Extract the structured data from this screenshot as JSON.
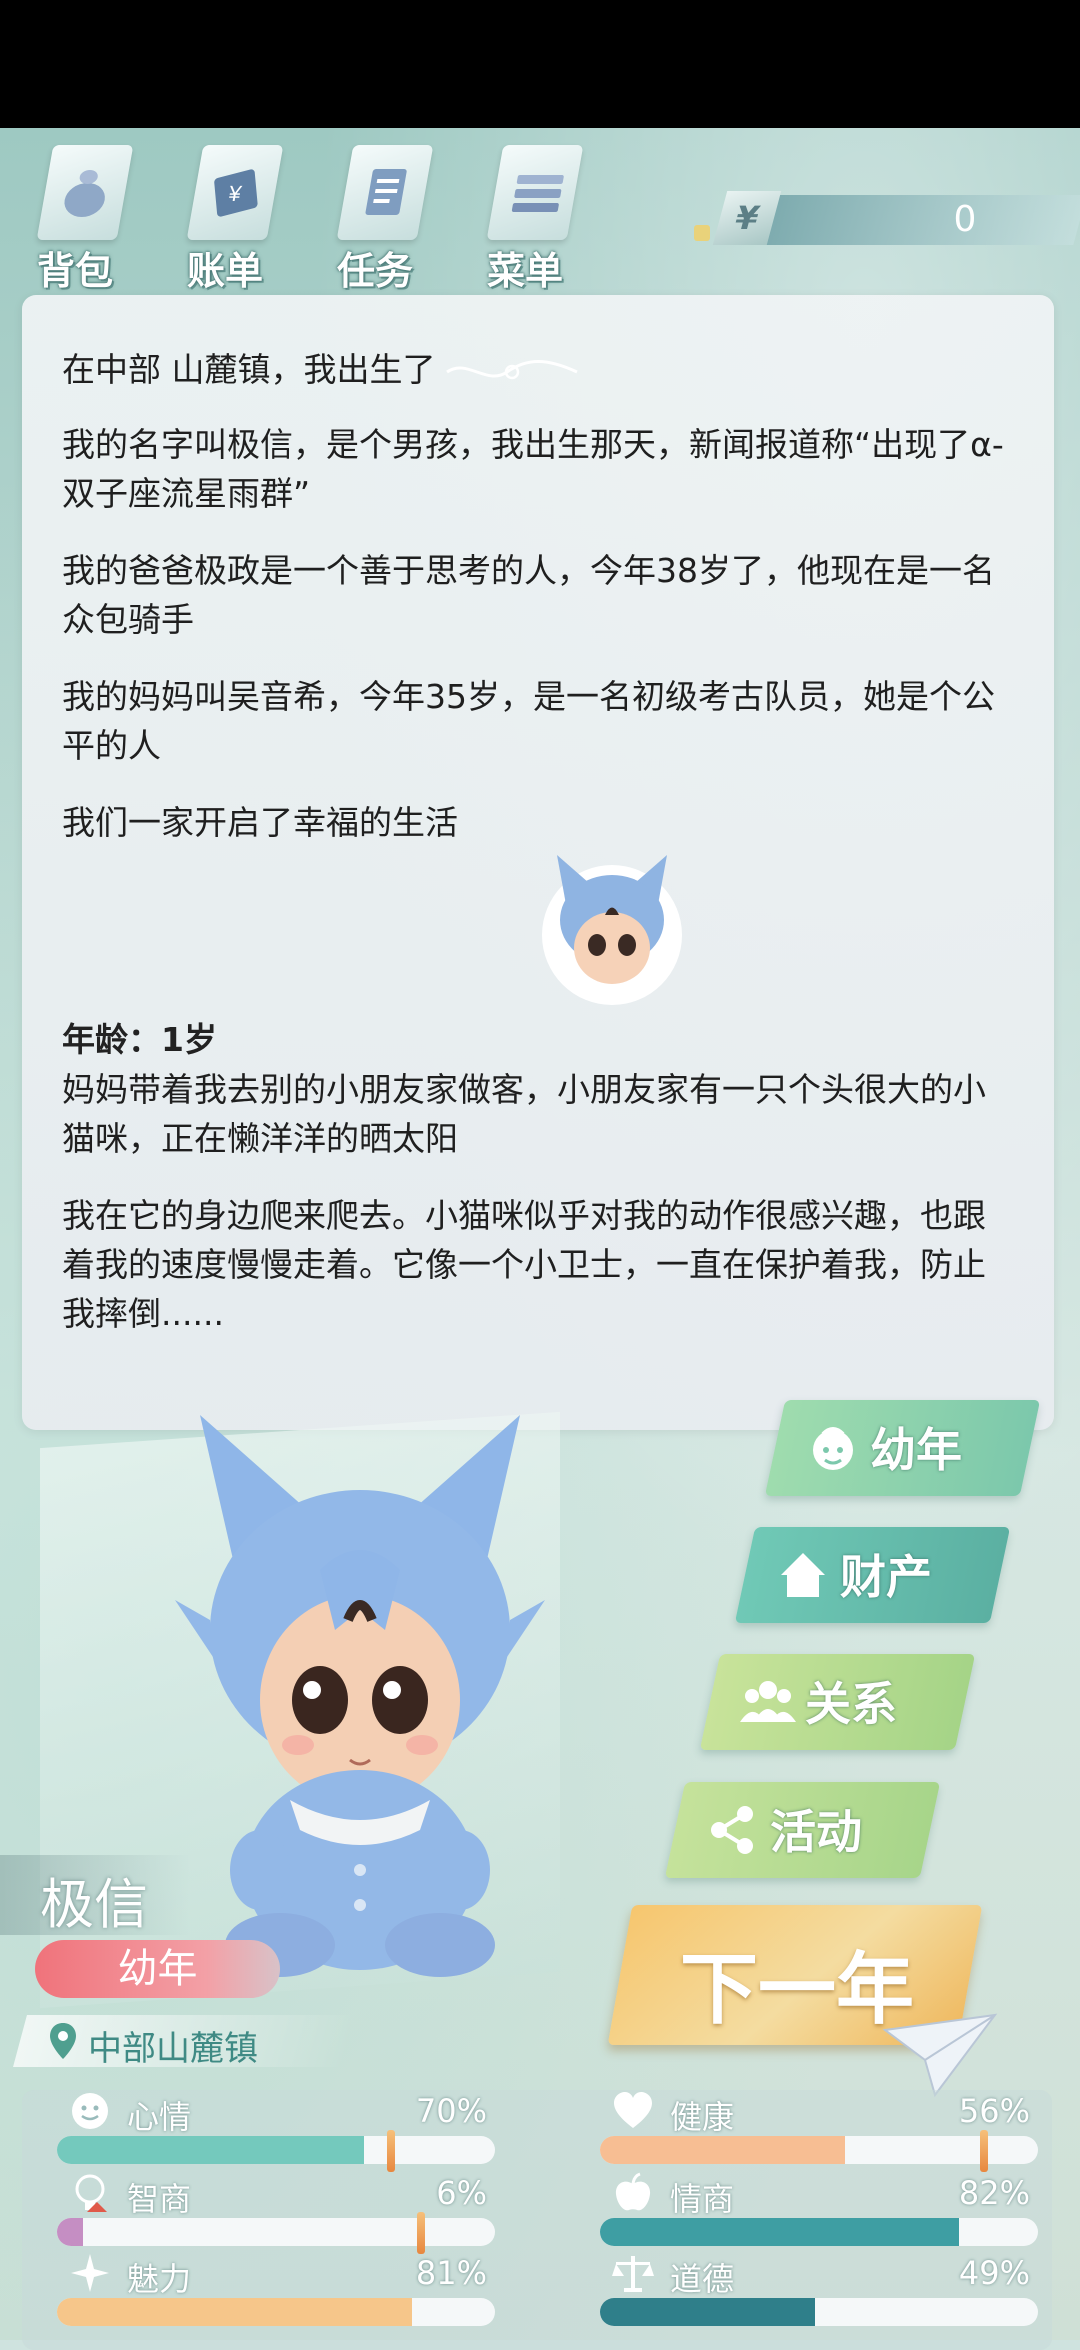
{
  "menu": {
    "items": [
      {
        "label": "背包",
        "icon": "bag-icon"
      },
      {
        "label": "账单",
        "icon": "bill-icon"
      },
      {
        "label": "任务",
        "icon": "task-icon"
      },
      {
        "label": "菜单",
        "icon": "menu-icon"
      }
    ]
  },
  "money": {
    "symbol": "¥",
    "value": "0"
  },
  "story": {
    "paragraphs_block1": [
      "在中部 山麓镇，我出生了",
      "我的名字叫极信，是个男孩，我出生那天，新闻报道称“出现了α-双子座流星雨群”",
      "我的爸爸极政是一个善于思考的人，今年38岁了，他现在是一名众包骑手",
      "我的妈妈叫吴音希，今年35岁，是一名初级考古队员，她是个公平的人",
      "我们一家开启了幸福的生活"
    ],
    "age_heading": "年龄：1岁",
    "paragraphs_block2": [
      "妈妈带着我去别的小朋友家做客，小朋友家有一只个头很大的小猫咪，正在懒洋洋的晒太阳",
      "我在它的身边爬来爬去。小猫咪似乎对我的动作很感兴趣，也跟着我的速度慢慢走着。它像一个小卫士，一直在保护着我，防止我摔倒......"
    ]
  },
  "actions": [
    {
      "label": "幼年",
      "icon": "baby-icon",
      "color": "#8fd3a8"
    },
    {
      "label": "财产",
      "icon": "house-icon",
      "color": "#6cc5b0"
    },
    {
      "label": "关系",
      "icon": "people-icon",
      "color": "#b9dc8e"
    },
    {
      "label": "活动",
      "icon": "activity-icon",
      "color": "#b4d889"
    }
  ],
  "next_year": {
    "label": "下一年"
  },
  "character": {
    "name": "极信",
    "stage": "幼年",
    "location": "中部山麓镇"
  },
  "stats": [
    {
      "name": "心情",
      "value": "70%",
      "level": 0.7,
      "color": "#74c9bd",
      "icon": "smile-icon"
    },
    {
      "name": "健康",
      "value": "56%",
      "level": 0.56,
      "color": "#f7be93",
      "icon": "heart-icon"
    },
    {
      "name": "智商",
      "value": "6%",
      "level": 0.06,
      "color": "#c58ec3",
      "icon": "bulb-icon"
    },
    {
      "name": "情商",
      "value": "82%",
      "level": 0.82,
      "color": "#3e9ea3",
      "icon": "apple-icon"
    },
    {
      "name": "魅力",
      "value": "81%",
      "level": 0.81,
      "color": "#f6c68a",
      "icon": "sparkle-icon"
    },
    {
      "name": "道德",
      "value": "49%",
      "level": 0.49,
      "color": "#2f7f8a",
      "icon": "scale-icon"
    }
  ]
}
